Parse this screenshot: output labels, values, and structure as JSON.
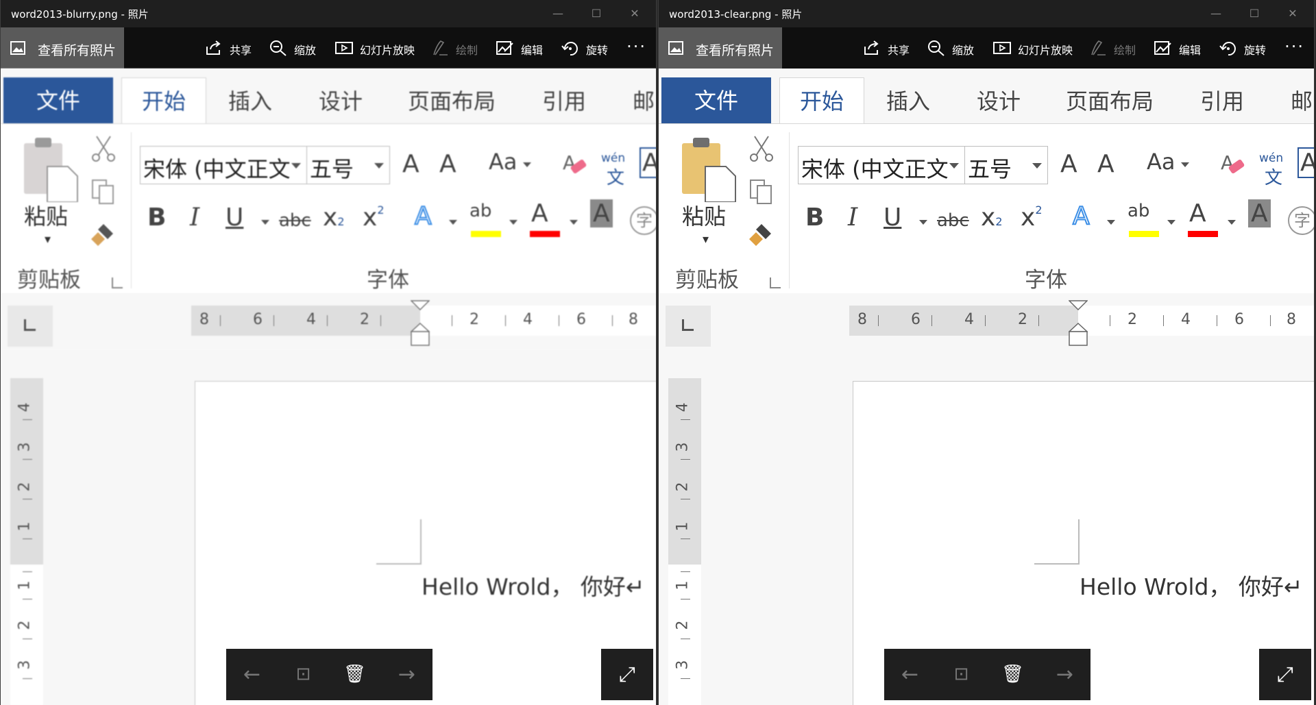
{
  "panes": [
    {
      "title": "word2013-blurry.png - 照片",
      "image_state": "blurry"
    },
    {
      "title": "word2013-clear.png - 照片",
      "image_state": "clear"
    }
  ],
  "window_controls": {
    "minimize": "—",
    "maximize": "☐",
    "close": "✕"
  },
  "photos_toolbar": {
    "view_all": "查看所有照片",
    "share": "共享",
    "zoom": "缩放",
    "slideshow": "幻灯片放映",
    "draw": "绘制",
    "edit": "编辑",
    "rotate": "旋转",
    "more": "···"
  },
  "word": {
    "tabs": {
      "file": "文件",
      "home": "开始",
      "insert": "插入",
      "design": "设计",
      "layout": "页面布局",
      "references": "引用",
      "mail": "邮"
    },
    "clipboard": {
      "paste": "粘贴",
      "group_label": "剪贴板"
    },
    "font": {
      "font_name": "宋体 (中文正文",
      "font_size": "五号",
      "group_label": "字体",
      "grow": "A",
      "shrink": "A",
      "case": "Aa",
      "bold": "B",
      "italic": "I",
      "underline": "U",
      "strike": "abc",
      "subscript": "x",
      "superscript": "x",
      "sub_mark": "2",
      "sup_mark": "2",
      "text_effects": "A",
      "highlight": "ab",
      "font_color": "A",
      "char_shading": "A",
      "enclose": "字",
      "phonetic_top": "wén",
      "phonetic_bottom": "文",
      "border_a": "A"
    },
    "ruler": {
      "horizontal": [
        "8",
        "6",
        "4",
        "2",
        "2",
        "4",
        "6",
        "8"
      ],
      "vertical": [
        "4",
        "3",
        "2",
        "1",
        "1",
        "2",
        "3"
      ]
    },
    "document_text": "Hello Wrold， 你好↵"
  },
  "nav": {
    "prev": "←",
    "feedback": "⊡",
    "delete": "🗑",
    "next": "→",
    "fullscreen": "⤢"
  },
  "colors": {
    "word_blue": "#2b579a",
    "highlight_yellow": "#ffff00",
    "font_red": "#ff0000",
    "paste_clipboard_clear": "#e8c372",
    "paste_clipboard_blurry": "#d8d4d4"
  }
}
